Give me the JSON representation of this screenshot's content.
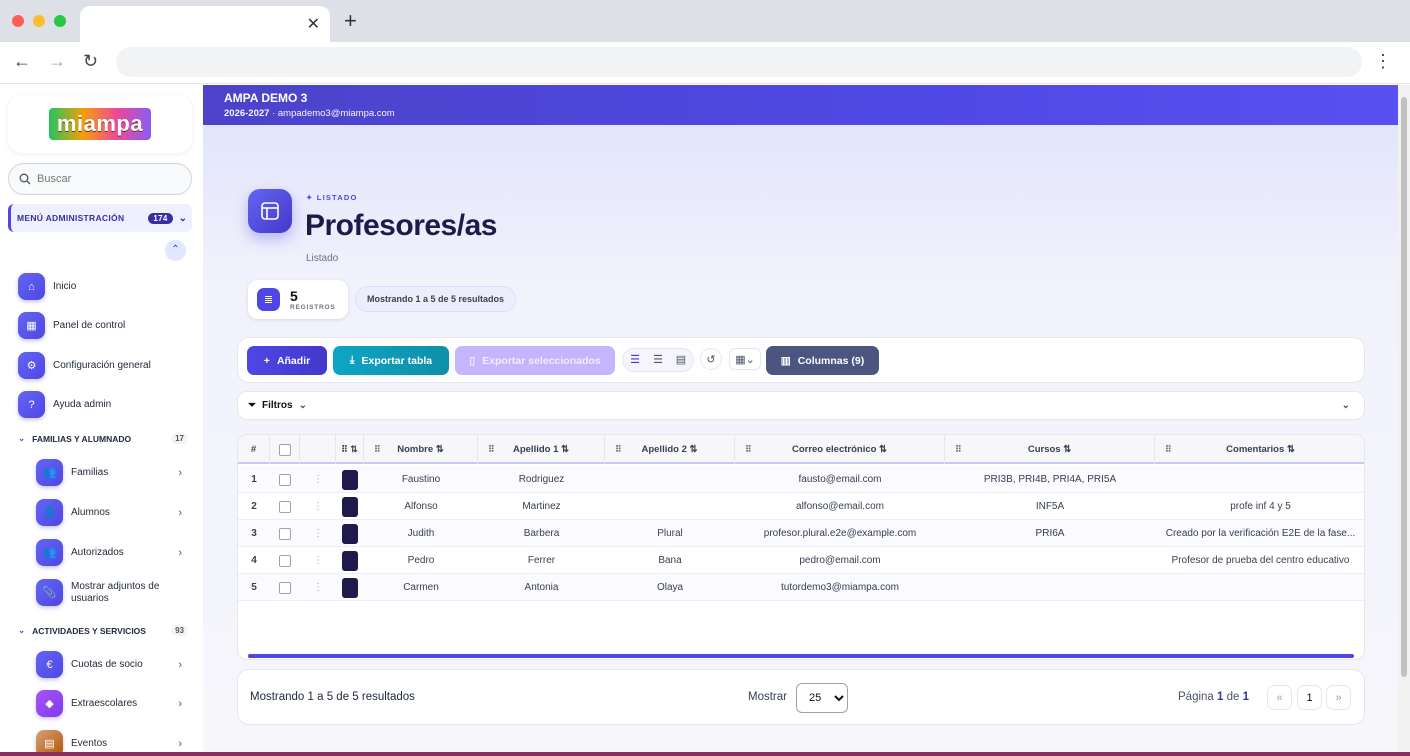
{
  "browser": {
    "tab_close": "✕",
    "new_tab": "+",
    "back": "←",
    "forward": "→",
    "reload": "↻",
    "menu": "⋮"
  },
  "sidebar": {
    "logo_text": "miampa",
    "search_placeholder": "Buscar",
    "admin_menu_label": "MENÚ ADMINISTRACIÓN",
    "admin_menu_count": "174",
    "top_items": [
      {
        "label": "Inicio",
        "icon": "home-icon"
      },
      {
        "label": "Panel de control",
        "icon": "dashboard-icon"
      },
      {
        "label": "Configuración general",
        "icon": "settings-icon"
      },
      {
        "label": "Ayuda admin",
        "icon": "help-icon"
      }
    ],
    "section1": {
      "label": "FAMILIAS Y ALUMNADO",
      "count": "17"
    },
    "section1_items": [
      {
        "label": "Familias",
        "icon": "users-icon"
      },
      {
        "label": "Alumnos",
        "icon": "user-icon"
      },
      {
        "label": "Autorizados",
        "icon": "users-icon"
      },
      {
        "label": "Mostrar adjuntos de usuarios",
        "icon": "paperclip-icon"
      }
    ],
    "section2": {
      "label": "ACTIVIDADES Y SERVICIOS",
      "count": "93"
    },
    "section2_items": [
      {
        "label": "Cuotas de socio",
        "icon": "euro-icon"
      },
      {
        "label": "Extraescolares",
        "icon": "diamond-icon"
      },
      {
        "label": "Eventos",
        "icon": "calendar-icon"
      }
    ]
  },
  "header": {
    "org": "AMPA DEMO 3",
    "year": "2026-2027",
    "sep": "·",
    "email": "ampademo3@miampa.com"
  },
  "page": {
    "kicker": "LISTADO",
    "title": "Profesores/as",
    "subtitle": "Listado",
    "records_count": "5",
    "records_label": "REGISTROS",
    "showing": "Mostrando 1 a 5 de 5 resultados"
  },
  "toolbar": {
    "add": "Añadir",
    "export_table": "Exportar tabla",
    "export_selected": "Exportar seleccionados",
    "columns": "Columnas (9)"
  },
  "filters": {
    "label": "Filtros"
  },
  "table": {
    "headers": [
      "#",
      "Nombre",
      "Apellido 1",
      "Apellido 2",
      "Correo electrónico",
      "Cursos",
      "Comentarios"
    ],
    "rows": [
      {
        "n": "1",
        "nombre": "Faustino",
        "ap1": "Rodriguez",
        "ap2": "",
        "email": "fausto@email.com",
        "cursos": "PRI3B, PRI4B, PRI4A, PRI5A",
        "comentarios": ""
      },
      {
        "n": "2",
        "nombre": "Alfonso",
        "ap1": "Martinez",
        "ap2": "",
        "email": "alfonso@email.com",
        "cursos": "INF5A",
        "comentarios": "profe inf 4 y 5"
      },
      {
        "n": "3",
        "nombre": "Judith",
        "ap1": "Barbera",
        "ap2": "Plural",
        "email": "profesor.plural.e2e@example.com",
        "cursos": "PRI6A",
        "comentarios": "Creado por la verificación E2E de la fase..."
      },
      {
        "n": "4",
        "nombre": "Pedro",
        "ap1": "Ferrer",
        "ap2": "Bana",
        "email": "pedro@email.com",
        "cursos": "",
        "comentarios": "Profesor de prueba del centro educativo"
      },
      {
        "n": "5",
        "nombre": "Carmen",
        "ap1": "Antonia",
        "ap2": "Olaya",
        "email": "tutordemo3@miampa.com",
        "cursos": "",
        "comentarios": ""
      }
    ]
  },
  "pagination": {
    "summary": "Mostrando 1 a 5 de 5 resultados",
    "show_label": "Mostrar",
    "page_size": "25",
    "page_word": "Página",
    "current": "1",
    "of_word": "de",
    "total": "1",
    "prev": "«",
    "next": "»"
  },
  "colors": {
    "accent": "#4f46e5",
    "teal": "#0e9fb5",
    "slate": "#4b5580"
  }
}
